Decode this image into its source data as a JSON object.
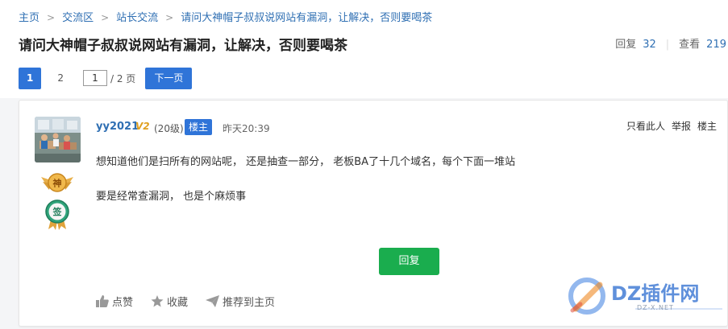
{
  "breadcrumb": [
    {
      "label": "主页"
    },
    {
      "label": "交流区"
    },
    {
      "label": "站长交流"
    },
    {
      "label": "请问大神帽子叔叔说网站有漏洞，让解决，否则要喝茶"
    }
  ],
  "thread": {
    "title": "请问大神帽子叔叔说网站有漏洞，让解决，否则要喝茶",
    "reply_label": "回复",
    "reply_count": "32",
    "view_label": "查看",
    "view_count": "219"
  },
  "pager": {
    "page1": "1",
    "page2": "2",
    "current_input": "1",
    "total": "/ 2 页",
    "next_label": "下一页"
  },
  "post": {
    "username": "yy2021",
    "vip_badge": "V2",
    "level": "(20级)",
    "role_badge": "楼主",
    "time": "昨天20:39",
    "actions": [
      "只看此人",
      "举报",
      "楼主"
    ],
    "medal1_text": "神",
    "medal2_text": "签",
    "content": [
      "想知道他们是扫所有的网站呢， 还是抽查一部分， 老板BA了十几个域名，每个下面一堆站",
      "要是经常查漏洞， 也是个麻烦事"
    ],
    "reply_button": "回复",
    "footer_actions": {
      "like": "点赞",
      "favorite": "收藏",
      "recommend": "推荐到主页"
    }
  },
  "watermark": {
    "brand": "DZ插件网",
    "sub": "DZ-X.NET"
  },
  "colors": {
    "link_blue": "#2f6fb3",
    "primary_blue": "#2f74d8",
    "reply_green": "#1aad4e"
  }
}
